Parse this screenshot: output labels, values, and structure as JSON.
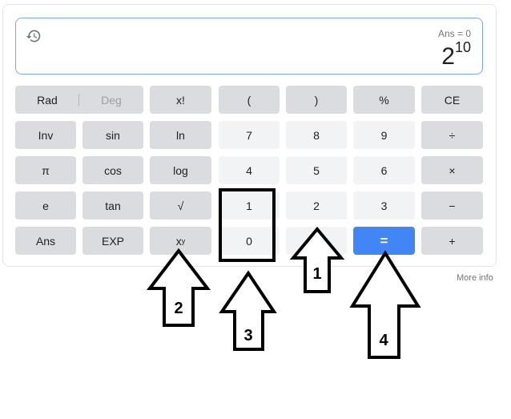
{
  "display": {
    "ans": "Ans = 0",
    "result_base": "2",
    "result_exp": "10"
  },
  "keys": {
    "rad": "Rad",
    "deg": "Deg",
    "fact": "x!",
    "lparen": "(",
    "rparen": ")",
    "percent": "%",
    "ce": "CE",
    "inv": "Inv",
    "sin": "sin",
    "ln": "ln",
    "seven": "7",
    "eight": "8",
    "nine": "9",
    "divide": "÷",
    "pi": "π",
    "cos": "cos",
    "log": "log",
    "four": "4",
    "five": "5",
    "six": "6",
    "multiply": "×",
    "e": "e",
    "tan": "tan",
    "sqrt": "√",
    "one": "1",
    "two": "2",
    "three": "3",
    "minus": "−",
    "ans": "Ans",
    "exp": "EXP",
    "power_base": "x",
    "power_exp": "y",
    "zero": "0",
    "dot": ".",
    "equals": "=",
    "plus": "+"
  },
  "footer": {
    "more_info": "More info"
  },
  "annotations": {
    "a1": "1",
    "a2": "2",
    "a3": "3",
    "a4": "4"
  }
}
